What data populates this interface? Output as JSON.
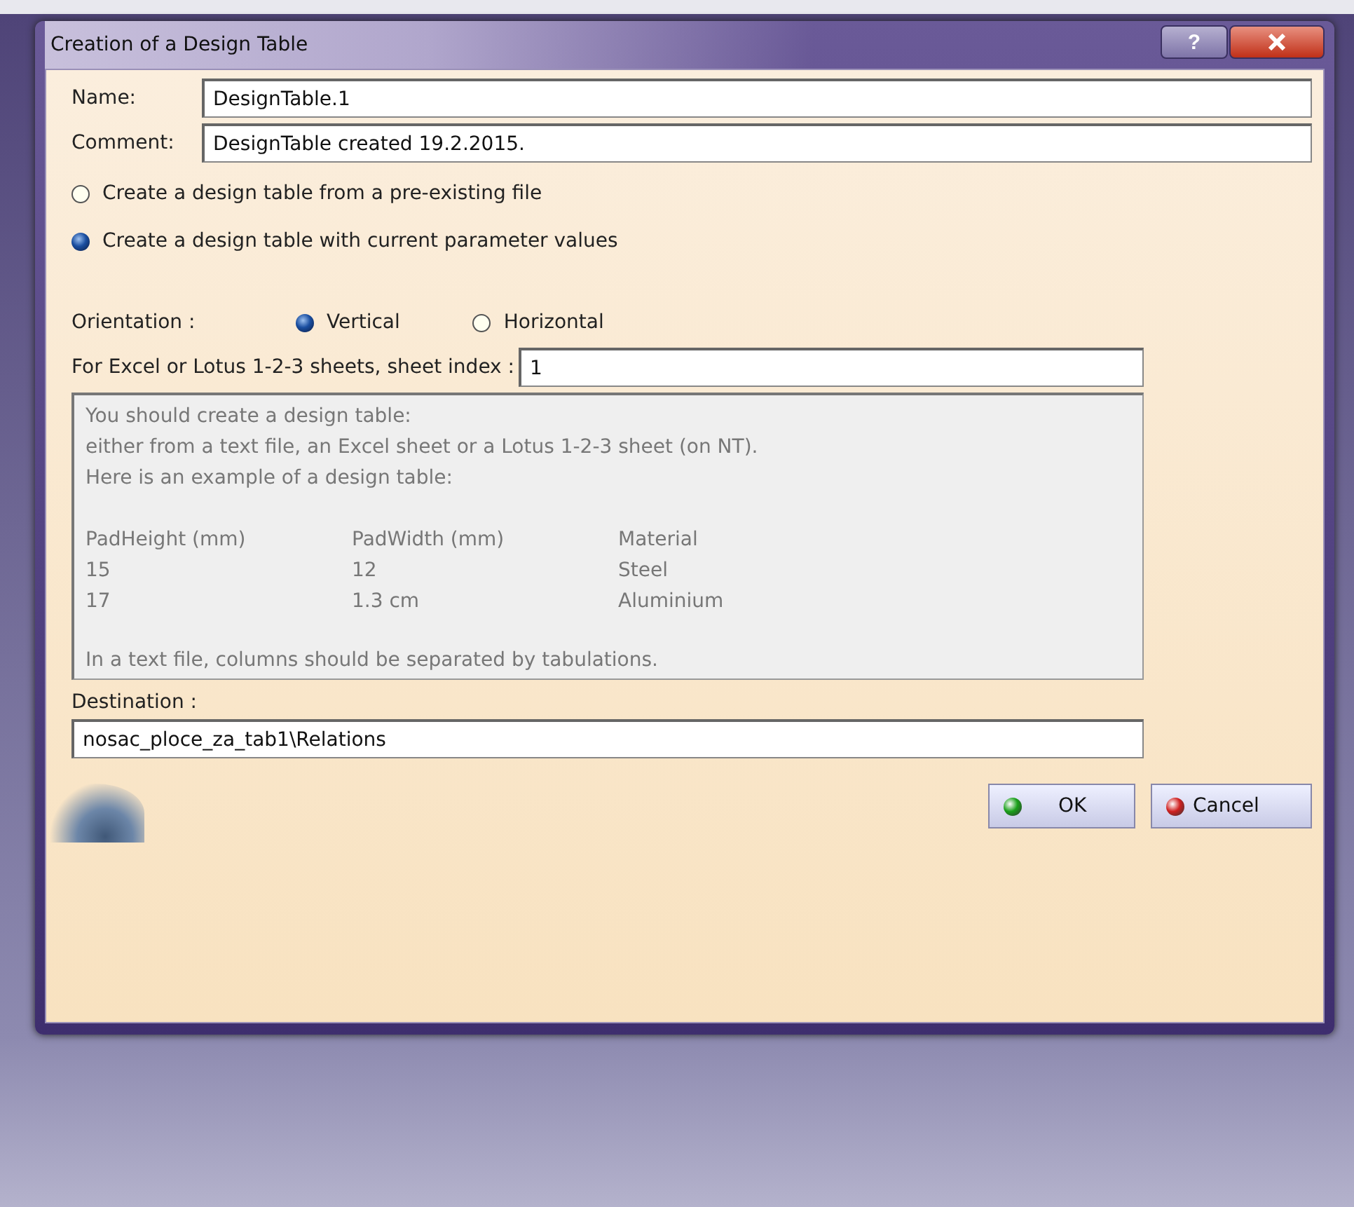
{
  "window": {
    "title": "Creation of a Design Table",
    "help_label": "?"
  },
  "fields": [
    {
      "label": "Name:",
      "value": "DesignTable.1"
    },
    {
      "label": "Comment:",
      "value": "DesignTable created 19.2.2015."
    }
  ],
  "source_options": [
    {
      "label": "Create a design table from a pre-existing file",
      "selected": false
    },
    {
      "label": "Create a design table with current parameter values",
      "selected": true
    }
  ],
  "orientation": {
    "label": "Orientation :",
    "options": [
      {
        "label": "Vertical",
        "selected": true
      },
      {
        "label": "Horizontal",
        "selected": false
      }
    ]
  },
  "sheet_index": {
    "label": "For Excel or Lotus 1-2-3 sheets, sheet index :",
    "value": "1"
  },
  "info": {
    "lines": [
      "You should create a design table:",
      "either from a text file, an Excel sheet or a Lotus 1-2-3 sheet (on NT).",
      "Here is an example of a design table:"
    ],
    "example_rows": [
      [
        "PadHeight (mm)",
        "PadWidth (mm)",
        "Material"
      ],
      [
        "15",
        "12",
        "Steel"
      ],
      [
        "17",
        "1.3 cm",
        "Aluminium"
      ]
    ],
    "footer": "In a text file, columns should be separated by tabulations."
  },
  "destination": {
    "label": "Destination :",
    "value": "nosac_ploce_za_tab1\\Relations"
  },
  "buttons": [
    {
      "label": "OK",
      "kind": "ok"
    },
    {
      "label": "Cancel",
      "kind": "cancel"
    }
  ]
}
